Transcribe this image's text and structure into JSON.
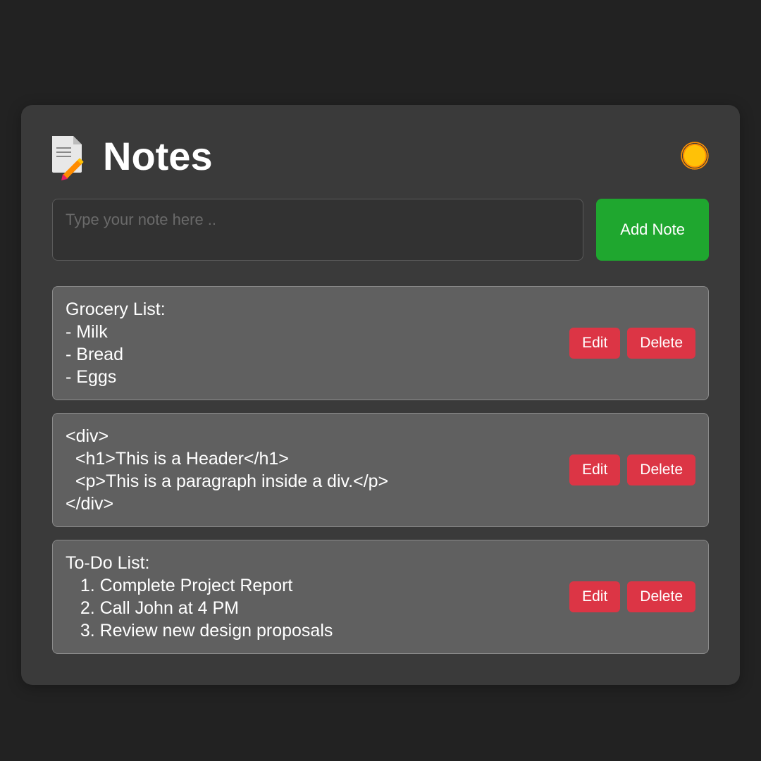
{
  "header": {
    "title": "Notes"
  },
  "input": {
    "placeholder": "Type your note here ..",
    "add_label": "Add Note"
  },
  "notes": [
    {
      "text": "Grocery List:\n- Milk\n- Bread\n- Eggs",
      "edit_label": "Edit",
      "delete_label": "Delete"
    },
    {
      "text": "<div>\n  <h1>This is a Header</h1>\n  <p>This is a paragraph inside a div.</p>\n</div>",
      "edit_label": "Edit",
      "delete_label": "Delete"
    },
    {
      "text": "To-Do List:\n   1. Complete Project Report\n   2. Call John at 4 PM\n   3. Review new design proposals",
      "edit_label": "Edit",
      "delete_label": "Delete"
    }
  ]
}
